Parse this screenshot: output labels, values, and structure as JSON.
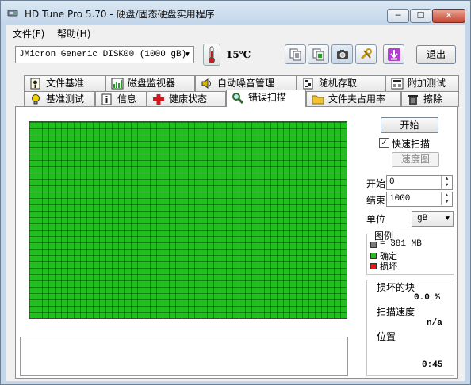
{
  "window": {
    "title": "HD Tune Pro 5.70 - 硬盘/固态硬盘实用程序",
    "min_label": "─",
    "max_label": "☐",
    "close_label": "✕"
  },
  "menu": {
    "file": "文件(F)",
    "help": "帮助(H)"
  },
  "toolbar": {
    "drive": "JMicron Generic DISK00 (1000 gB)",
    "temperature": "15℃",
    "buttons": [
      "copy-text-icon",
      "copy-info-icon",
      "screenshot-camera-icon",
      "settings-tools-icon",
      "save-download-icon"
    ],
    "exit_label": "退出"
  },
  "tabs": {
    "row1": [
      "文件基准",
      "磁盘监视器",
      "自动噪音管理",
      "随机存取",
      "附加测试"
    ],
    "row2": [
      "基准测试",
      "信息",
      "健康状态",
      "错误扫描",
      "文件夹占用率",
      "擦除"
    ],
    "active": "错误扫描"
  },
  "scan": {
    "start_label": "开始",
    "quick_scan_label": "快速扫描",
    "quick_scan_checked": true,
    "map_label": "速度图",
    "start_field_label": "开始",
    "start_value": "0",
    "end_field_label": "结束",
    "end_value": "1000",
    "unit_label": "单位",
    "unit_value": "gB",
    "legend_title": "图例",
    "legend_block": "= 381 MB",
    "legend_ok": "确定",
    "legend_bad": "损坏",
    "damaged_label": "损坏的块",
    "damaged_value": "0.0 %",
    "speed_label": "扫描速度",
    "speed_value": "n/a",
    "position_label": "位置",
    "elapsed_value": "0:45"
  },
  "colors": {
    "ok": "#22c01f",
    "bad": "#e01a1a",
    "unscanned": "#7a7a7a"
  }
}
